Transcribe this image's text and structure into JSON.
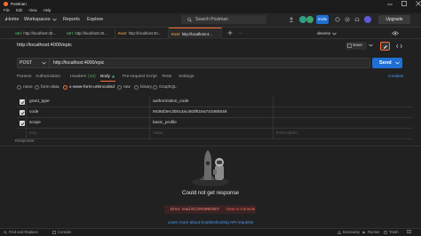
{
  "window": {
    "title": "Postman"
  },
  "menu": [
    "File",
    "Edit",
    "View",
    "Help"
  ],
  "nav": {
    "home": "Home",
    "workspaces": "Workspaces",
    "reports": "Reports",
    "explore": "Explore"
  },
  "search": {
    "placeholder": "Search Postman"
  },
  "header": {
    "invite": "Invite",
    "upgrade": "Upgrade"
  },
  "tabs": [
    {
      "method": "GET",
      "label": "http://localhost:40..."
    },
    {
      "method": "GET",
      "label": "http://localhost:40..."
    },
    {
      "method": "POST",
      "label": "http://localhost:40..."
    },
    {
      "method": "POST",
      "label": "http://localhost:4..."
    }
  ],
  "environment": "deverio",
  "request": {
    "title": "http://localhost:4000/epic",
    "save_label": "Save",
    "method": "POST",
    "url": "http://localhost:4000/epic",
    "send_label": "Send"
  },
  "request_tabs": {
    "params": "Params",
    "authorization": "Authorization",
    "headers": "Headers",
    "headers_count": "(10)",
    "body": "Body",
    "prerequest": "Pre-request Script",
    "tests": "Tests",
    "settings": "Settings",
    "cookies": "Cookies"
  },
  "body_types": [
    "none",
    "form-data",
    "x-www-form-urlencoded",
    "raw",
    "binary",
    "GraphQL"
  ],
  "form_rows": [
    {
      "key": "grant_type",
      "value": "authorization_code"
    },
    {
      "key": "code",
      "value": "9436d3ec3b514ac483f616a74346b046"
    },
    {
      "key": "scope",
      "value": "basic_profile"
    }
  ],
  "placeholders": {
    "key": "Key",
    "value": "Value",
    "description": "Description"
  },
  "response": {
    "header": "Response",
    "message": "Could not get response",
    "error": "Error: read ECONNRESET",
    "view_console": "View in Console",
    "learn_more": "Learn more about troubleshooting API requests"
  },
  "statusbar": {
    "find_replace": "Find and Replace",
    "console": "Console",
    "bootcamp": "Bootcamp",
    "runner": "Runner",
    "trash": "Trash"
  },
  "colors": {
    "accent": "#ff6c37",
    "primary": "#1f6fd4",
    "link": "#4e9cf2"
  }
}
